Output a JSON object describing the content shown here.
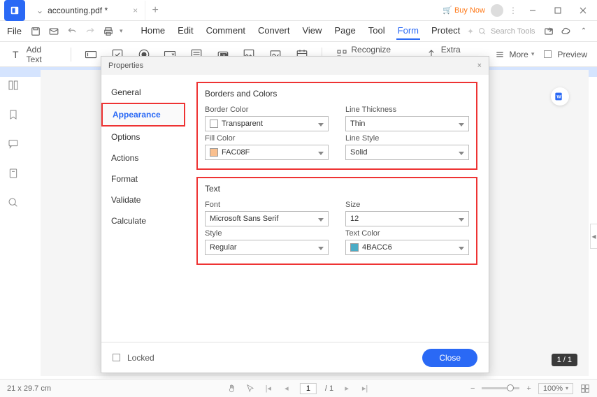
{
  "tab": {
    "title": "accounting.pdf *"
  },
  "titlebar": {
    "buy": "Buy Now",
    "menu_vdots": "⋮"
  },
  "menu": {
    "file": "File",
    "items": [
      "Home",
      "Edit",
      "Comment",
      "Convert",
      "View",
      "Page",
      "Tool",
      "Form",
      "Protect"
    ],
    "search_placeholder": "Search Tools"
  },
  "toolbar": {
    "add_text": "Add Text",
    "recognize": "Recognize Form",
    "extra": "Extra Data",
    "more": "More",
    "preview": "Preview"
  },
  "properties": {
    "title": "Properties",
    "tabs": [
      "General",
      "Appearance",
      "Options",
      "Actions",
      "Format",
      "Validate",
      "Calculate"
    ],
    "active_tab": "Appearance",
    "borders_title": "Borders and Colors",
    "border_color_label": "Border Color",
    "border_color_value": "Transparent",
    "line_thickness_label": "Line Thickness",
    "line_thickness_value": "Thin",
    "fill_color_label": "Fill Color",
    "fill_color_value": "FAC08F",
    "line_style_label": "Line Style",
    "line_style_value": "Solid",
    "text_title": "Text",
    "font_label": "Font",
    "font_value": "Microsoft Sans Serif",
    "size_label": "Size",
    "size_value": "12",
    "style_label": "Style",
    "style_value": "Regular",
    "text_color_label": "Text Color",
    "text_color_value": "4BACC6",
    "locked": "Locked",
    "close": "Close"
  },
  "colors": {
    "fill": "#FAC08F",
    "textcolor": "#4BACC6"
  },
  "status": {
    "dimensions": "21 x 29.7 cm",
    "page_current": "1",
    "page_total": "/ 1",
    "zoom": "100%"
  },
  "page_pill": "1 / 1"
}
